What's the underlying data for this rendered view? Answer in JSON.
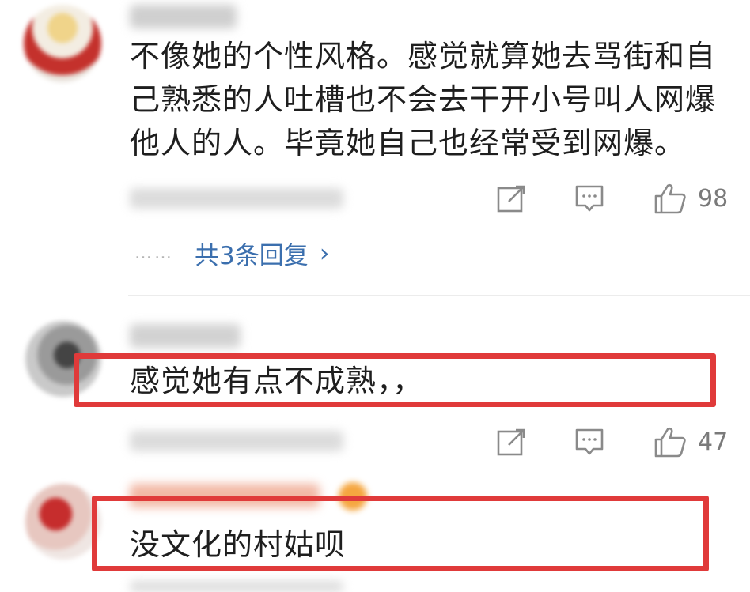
{
  "comments": [
    {
      "text": "不像她的个性风格。感觉就算她去骂街和自\n己熟悉的人吐槽也不会去干开小号叫人网爆\n他人的人。毕竟她自己也经常受到网爆。",
      "likes": "98",
      "replies_label": "共3条回复",
      "replies_dots": "……"
    },
    {
      "text": "感觉她有点不成熟，，",
      "likes": "47"
    },
    {
      "text": "没文化的村姑呗"
    }
  ],
  "icons": {
    "forward": "forward-icon",
    "comment": "comment-icon",
    "like": "thumbs-up-icon",
    "chevron": "chevron-right-icon"
  },
  "colors": {
    "highlight": "#e03a3a",
    "reply_link": "#3b6fae",
    "text": "#1e1e1e",
    "count": "#7a7a7a"
  }
}
